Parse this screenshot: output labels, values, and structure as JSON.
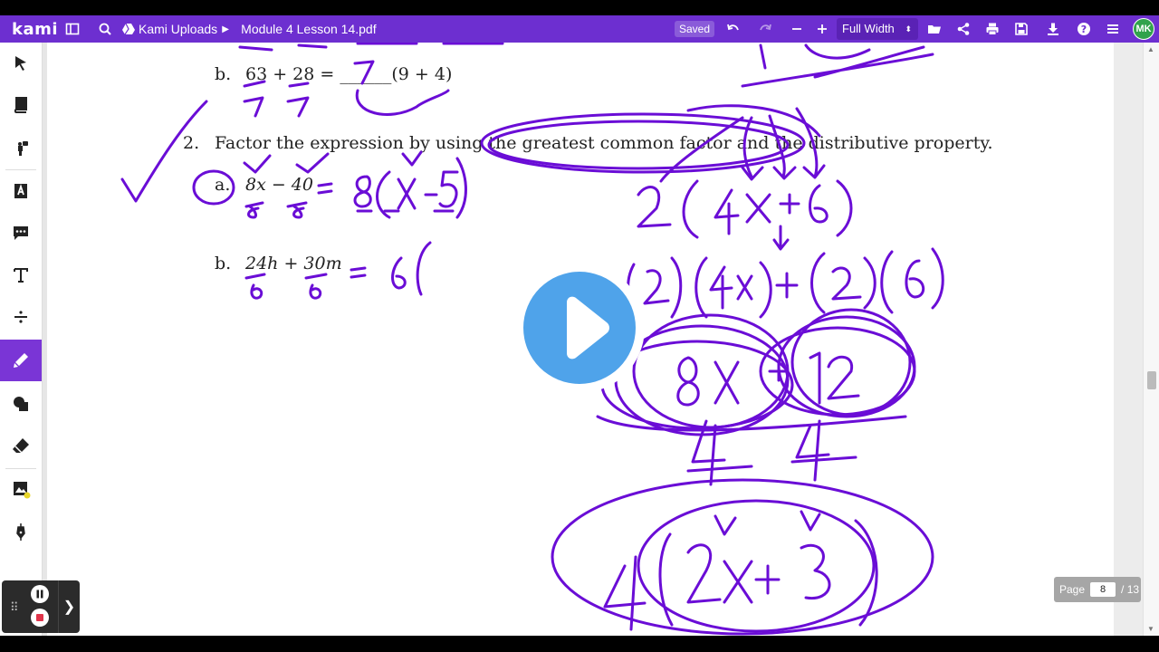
{
  "app": {
    "logo": "kami",
    "breadcrumb_folder": "Kami Uploads",
    "file_name": "Module 4 Lesson 14.pdf",
    "save_status": "Saved",
    "zoom_label": "Full Width",
    "user_initials": "MK"
  },
  "colors": {
    "brand": "#6d2fd0",
    "ink": "#6a0dd6",
    "active_tool": "#7a35d6",
    "avatar": "#31a24c",
    "play": "#4fa3ea"
  },
  "toolbar_icons": [
    "sidebar-toggle-icon",
    "search-icon",
    "drive-icon",
    "undo-icon",
    "redo-icon",
    "zoom-out-icon",
    "zoom-in-icon",
    "open-folder-icon",
    "share-icon",
    "print-icon",
    "save-icon",
    "download-icon",
    "help-icon",
    "menu-icon"
  ],
  "tools": [
    {
      "name": "select-tool",
      "icon": "cursor-icon"
    },
    {
      "name": "dictionary-tool",
      "icon": "book-icon"
    },
    {
      "name": "text-to-speech-tool",
      "icon": "speaker-icon"
    },
    {
      "name": "markup-tool",
      "icon": "highlighter-icon"
    },
    {
      "name": "comment-tool",
      "icon": "comment-icon"
    },
    {
      "name": "text-tool",
      "icon": "text-icon"
    },
    {
      "name": "equation-tool",
      "icon": "divide-icon"
    },
    {
      "name": "drawing-tool",
      "icon": "pen-icon",
      "active": true
    },
    {
      "name": "shapes-tool",
      "icon": "shapes-icon"
    },
    {
      "name": "eraser-tool",
      "icon": "eraser-icon"
    },
    {
      "name": "add-media-tool",
      "icon": "image-icon"
    },
    {
      "name": "signature-tool",
      "icon": "signature-pen-icon"
    }
  ],
  "document": {
    "q1b_label": "b.",
    "q1b_expr": "63 + 28 = ______(9 + 4)",
    "q2_number": "2.",
    "q2_text": "Factor the expression by using the greatest common factor and the distributive property.",
    "q2a_label": "a.",
    "q2a_expr": "8x − 40",
    "q2b_label": "b.",
    "q2b_expr": "24h + 30m"
  },
  "pagination": {
    "label": "Page",
    "current": "8",
    "total": "/ 13"
  }
}
